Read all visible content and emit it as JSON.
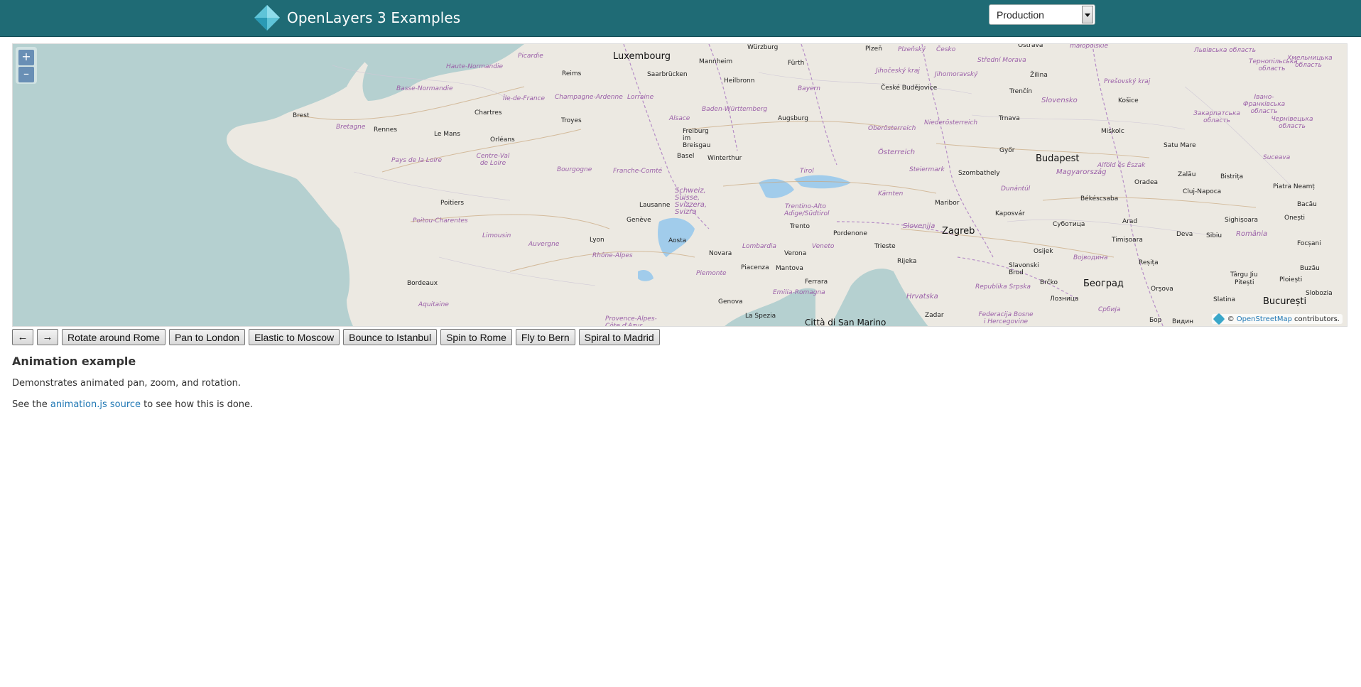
{
  "header": {
    "title": "OpenLayers 3 Examples",
    "mode_select": {
      "selected": "Production"
    }
  },
  "map": {
    "zoom_in": "+",
    "zoom_out": "–",
    "attribution": {
      "prefix": "©",
      "link": "OpenStreetMap",
      "suffix": "contributors."
    },
    "places": {
      "luxembourg": "Luxembourg",
      "budapest": "Budapest",
      "zagreb": "Zagreb",
      "beograd": "Београд",
      "bucuresti": "București",
      "citta": "Città di San Marino",
      "brest": "Brest",
      "rennes": "Rennes",
      "le_mans": "Le Mans",
      "chartres": "Chartres",
      "orleans": "Orléans",
      "reims": "Reims",
      "troyes": "Troyes",
      "poitiers": "Poitiers",
      "bordeaux": "Bordeaux",
      "lyon": "Lyon",
      "geneve": "Genève",
      "lausanne": "Lausanne",
      "basel": "Basel",
      "freiburg": "Freiburg im Breisgau",
      "winterthur": "Winterthur",
      "augsburg": "Augsburg",
      "mannheim": "Mannheim",
      "heilbronn": "Heilbronn",
      "saarbrucken": "Saarbrücken",
      "wurzburg": "Würzburg",
      "furth": "Fürth",
      "plzen": "Plzeň",
      "ceske": "České Budějovice",
      "ostrava": "Ostrava",
      "zilina": "Žilina",
      "trencin": "Trenčín",
      "trnava": "Trnava",
      "kosice": "Košice",
      "miskolc": "Miskolc",
      "gyor": "Győr",
      "szombathely": "Szombathely",
      "maribor": "Maribor",
      "kaposvar": "Kaposvár",
      "subotica": "Суботица",
      "osijek": "Osijek",
      "trento": "Trento",
      "verona": "Verona",
      "novara": "Novara",
      "aosta": "Aosta",
      "piacenza": "Piacenza",
      "mantova": "Mantova",
      "ferrara": "Ferrara",
      "genova": "Genova",
      "la_spezia": "La Spezia",
      "pordenone": "Pordenone",
      "trieste": "Trieste",
      "rijeka": "Rijeka",
      "zadar": "Zadar",
      "slavonski": "Slavonski Brod",
      "brcko": "Brčko",
      "oradea": "Oradea",
      "arad": "Arad",
      "timisoara": "Timișoara",
      "resita": "Reșița",
      "deva": "Deva",
      "cluj": "Cluj-Napoca",
      "zalau": "Zalău",
      "satu_mare": "Satu Mare",
      "bistrita": "Bistrița",
      "sighisoara": "Sighișoara",
      "targu_jiu": "Târgu Jiu",
      "pitesti": "Pitești",
      "ploiesti": "Ploiești",
      "slatina": "Slatina",
      "orsova": "Orșova",
      "piatra": "Piatra Neamț",
      "bacau": "Bacău",
      "onesti": "Onești",
      "focsani": "Focșani",
      "buzau": "Buzău",
      "slobozia": "Slobozia",
      "sibiu": "Sibiu",
      "bekescsaba": "Békéscsaba"
    },
    "regions": {
      "haute_normandie": "Haute-Normandie",
      "picardie": "Picardie",
      "basse_normandie": "Basse-Normandie",
      "ile_de_france": "Île-de-France",
      "champagne": "Champagne-Ardenne",
      "lorraine": "Lorraine",
      "alsace": "Alsace",
      "bretagne": "Bretagne",
      "pays_de_la_loire": "Pays de la Loire",
      "centre": "Centre-Val de Loire",
      "bourgogne": "Bourgogne",
      "franche_comte": "Franche-Comté",
      "poitou": "Poitou-Charentes",
      "limousin": "Limousin",
      "auvergne": "Auvergne",
      "rhone_alpes": "Rhône-Alpes",
      "aquitaine": "Aquitaine",
      "provence": "Provence-Alpes-Côte d'Azur",
      "baden": "Baden-Württemberg",
      "bayern": "Bayern",
      "schweiz": "Schweiz, Suisse, Svizzera, Svizra",
      "tirol": "Tirol",
      "trentino": "Trentino-Alto Adige/Südtirol",
      "lombardia": "Lombardia",
      "piemonte": "Piemonte",
      "emilia": "Emilia-Romagna",
      "veneto": "Veneto",
      "karnten": "Kärnten",
      "steiermark": "Steiermark",
      "oberosterreich": "Oberösterreich",
      "niederosterreich": "Niederösterreich",
      "osterreich": "Österreich",
      "slovenija": "Slovenija",
      "hrvatska": "Hrvatska",
      "jihocesky": "Jihočeský kraj",
      "jihomoravsky": "Jihomoravský",
      "cesko": "Česko",
      "stredni": "Střední Morava",
      "plzensky": "Plzeňský",
      "slovensko": "Slovensko",
      "presovsky": "Prešovský kraj",
      "magyarorszag": "Magyarország",
      "alfold": "Alföld és Észak",
      "dunantul": "Dunántúl",
      "vojvodina": "Војводина",
      "srbija": "Србија",
      "republika_srpska": "Republika Srpska",
      "federacija": "Federacija Bosne i Hercegovine",
      "romania": "România",
      "suceava": "Suceava",
      "zakarpattia": "Закарпатська область",
      "ivano": "Івано-Франківська область",
      "chernivtsi": "Чернівецька область",
      "lviv": "Львівська область",
      "ternopil": "Тернопільська область",
      "khmelnytsk": "Хмельницька область",
      "malopolskie": "małopolskie",
      "bor": "Бор",
      "vidin": "Видин",
      "loznica": "Лозница"
    }
  },
  "controls": {
    "rotate_left": "←",
    "rotate_right": "→",
    "rotate_around_rome": "Rotate around Rome",
    "pan_to_london": "Pan to London",
    "elastic_to_moscow": "Elastic to Moscow",
    "bounce_to_istanbul": "Bounce to Istanbul",
    "spin_to_rome": "Spin to Rome",
    "fly_to_bern": "Fly to Bern",
    "spiral_to_madrid": "Spiral to Madrid"
  },
  "content": {
    "title": "Animation example",
    "description": "Demonstrates animated pan, zoom, and rotation.",
    "source_prefix": "See the",
    "source_link": "animation.js source",
    "source_suffix": "to see how this is done."
  }
}
